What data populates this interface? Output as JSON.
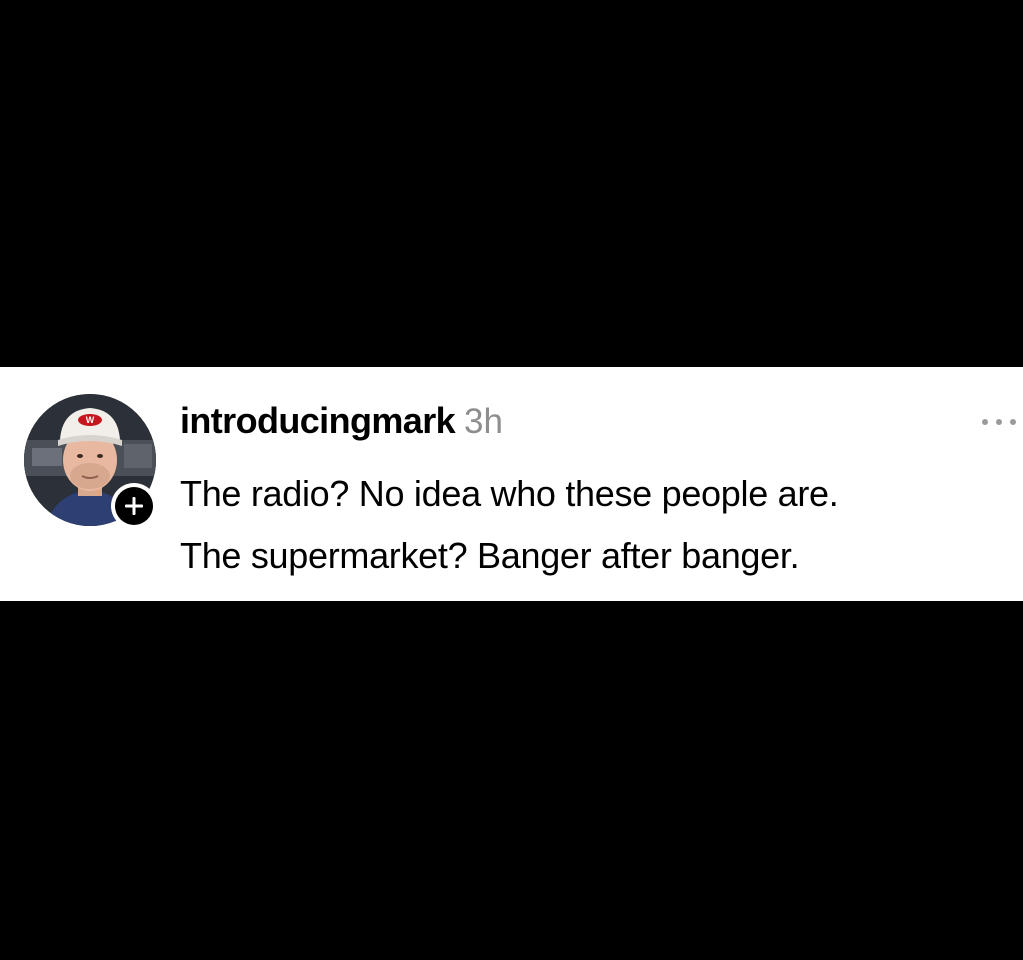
{
  "post": {
    "username": "introducingmark",
    "timestamp": "3h",
    "text_lines": [
      "The radio? No idea who these people are.",
      "The supermarket? Banger after banger."
    ]
  },
  "icons": {
    "avatar": "profile-photo",
    "follow": "plus-icon",
    "more": "ellipsis-icon"
  },
  "colors": {
    "background": "#000000",
    "card": "#ffffff",
    "username": "#000000",
    "timestamp": "#8e8e8e"
  }
}
